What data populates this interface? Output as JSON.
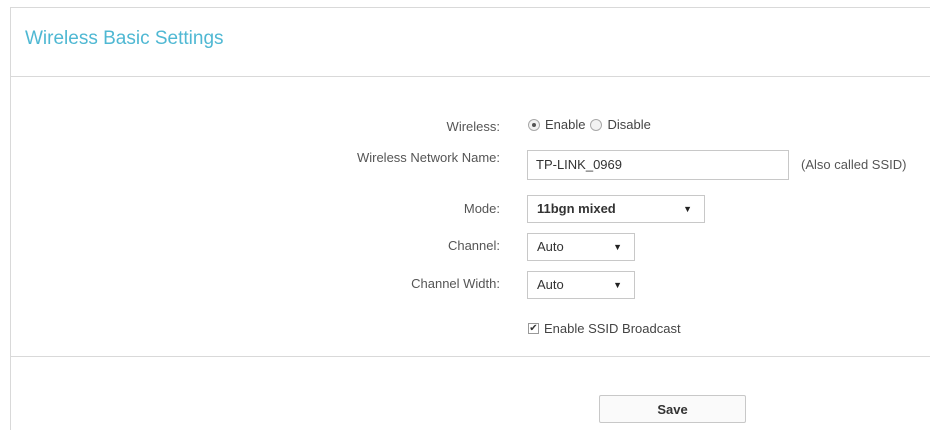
{
  "header": {
    "title": "Wireless Basic Settings"
  },
  "form": {
    "wireless": {
      "label": "Wireless:",
      "options": [
        {
          "label": "Enable",
          "checked": true
        },
        {
          "label": "Disable",
          "checked": false
        }
      ]
    },
    "network_name": {
      "label": "Wireless Network Name:",
      "value": "TP-LINK_0969",
      "hint": "(Also called SSID)"
    },
    "mode": {
      "label": "Mode:",
      "selected": "11bgn mixed"
    },
    "channel": {
      "label": "Channel:",
      "selected": "Auto"
    },
    "channel_width": {
      "label": "Channel Width:",
      "selected": "Auto"
    },
    "ssid_broadcast": {
      "label": "Enable SSID Broadcast",
      "checked": true
    }
  },
  "footer": {
    "save_label": "Save"
  },
  "colors": {
    "title": "#4fb8d3",
    "border": "#d9d9d9"
  },
  "icons": {
    "dropdown": "chevron-down-icon",
    "check": "checkmark-icon"
  }
}
